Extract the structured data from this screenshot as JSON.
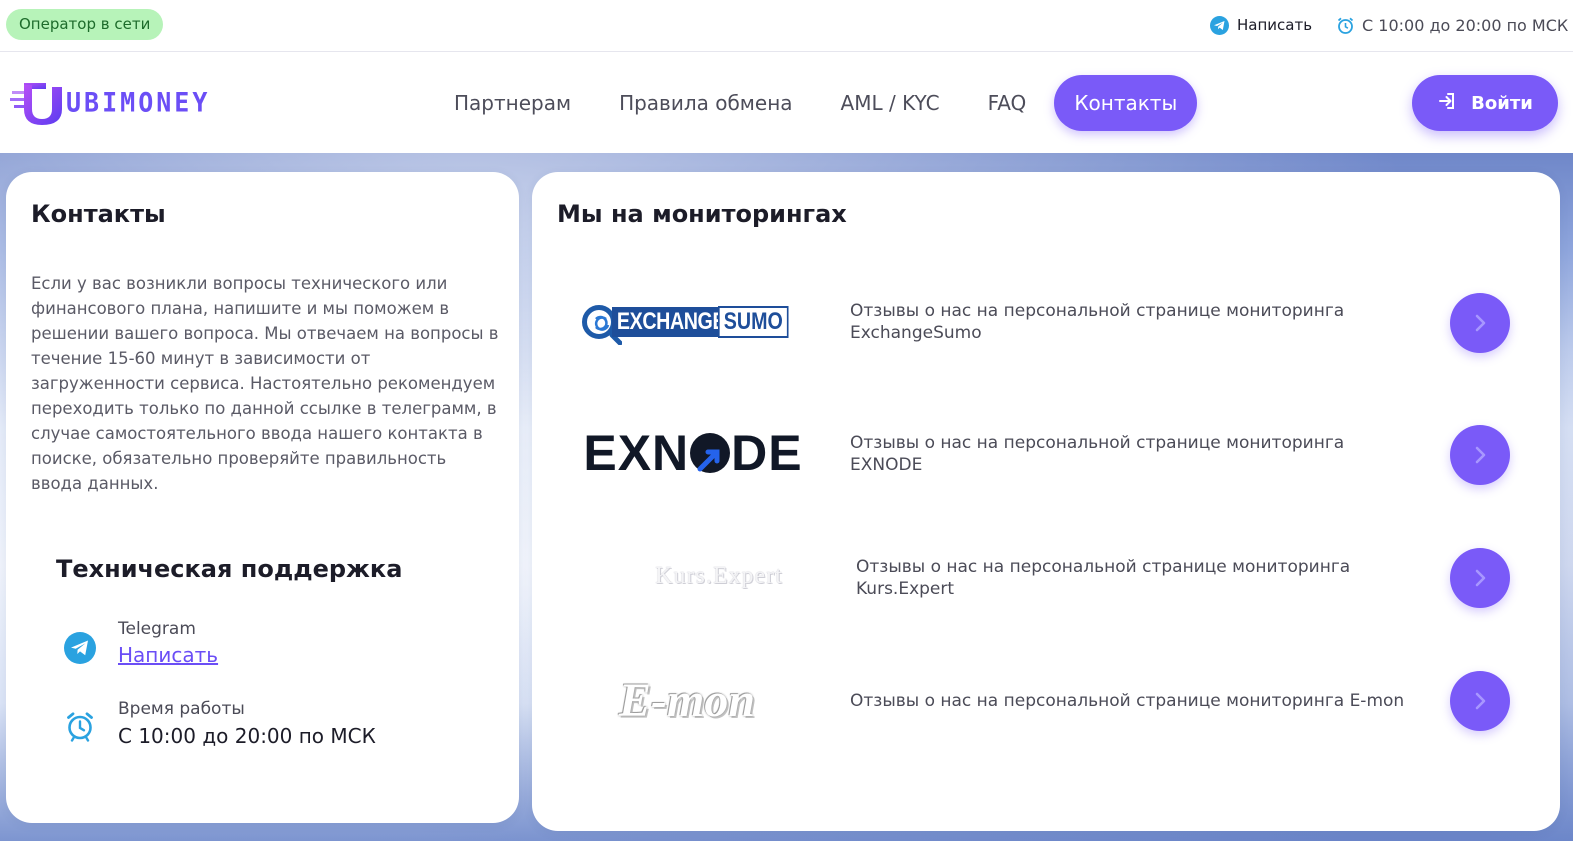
{
  "topbar": {
    "online_badge": "Оператор в сети",
    "write_label": "Написать",
    "hours": "С 10:00 до 20:00 по МСК"
  },
  "header": {
    "logo_text": "UBIMONEY",
    "nav": [
      "Партнерам",
      "Правила обмена",
      "AML / KYC",
      "FAQ",
      "Контакты"
    ],
    "active_nav": "Контакты",
    "login_label": "Войти"
  },
  "contacts": {
    "title": "Контакты",
    "intro": "Если у вас возникли вопросы технического или финансового плана, напишите и мы поможем в решении вашего вопроса. Мы отвечаем на вопросы в течение 15-60 минут в зависимости от загруженности сервиса. Настоятельно рекомендуем переходить только по данной ссылке в телеграмм, в случае самостоятельного ввода нашего контакта в поиске, обязательно проверяйте правильность ввода данных.",
    "support_title": "Техническая поддержка",
    "telegram_label": "Telegram",
    "telegram_link": "Написать",
    "hours_label": "Время работы",
    "hours_value": "С 10:00 до 20:00 по МСК"
  },
  "monitorings": {
    "title": "Мы на мониторингах",
    "items": [
      {
        "logo": "EXCHANGE SUMO",
        "logo_word1": "EXCHANGE",
        "logo_word2": "SUMO",
        "text": "Отзывы о нас на персональной странице мониторинга ExchangeSumo"
      },
      {
        "logo": "EXNODE",
        "logo_part1": "EXN",
        "logo_part2": "DE",
        "text": "Отзывы о нас на персональной странице мониторинга EXNODE"
      },
      {
        "logo": "Kurs.Expert",
        "text": "Отзывы о нас на персональной странице мониторинга Kurs.Expert"
      },
      {
        "logo": "E-mon",
        "text": "Отзывы о нас на персональной странице мониторинга E-mon"
      }
    ]
  },
  "colors": {
    "accent": "#7a5af8",
    "online_badge_bg": "#b7f3b9",
    "telegram": "#2aa2e0"
  },
  "icons": {
    "telegram": "telegram-icon",
    "clock": "alarm-clock-icon",
    "login": "login-arrow-icon",
    "chevron": "chevron-right-icon"
  }
}
